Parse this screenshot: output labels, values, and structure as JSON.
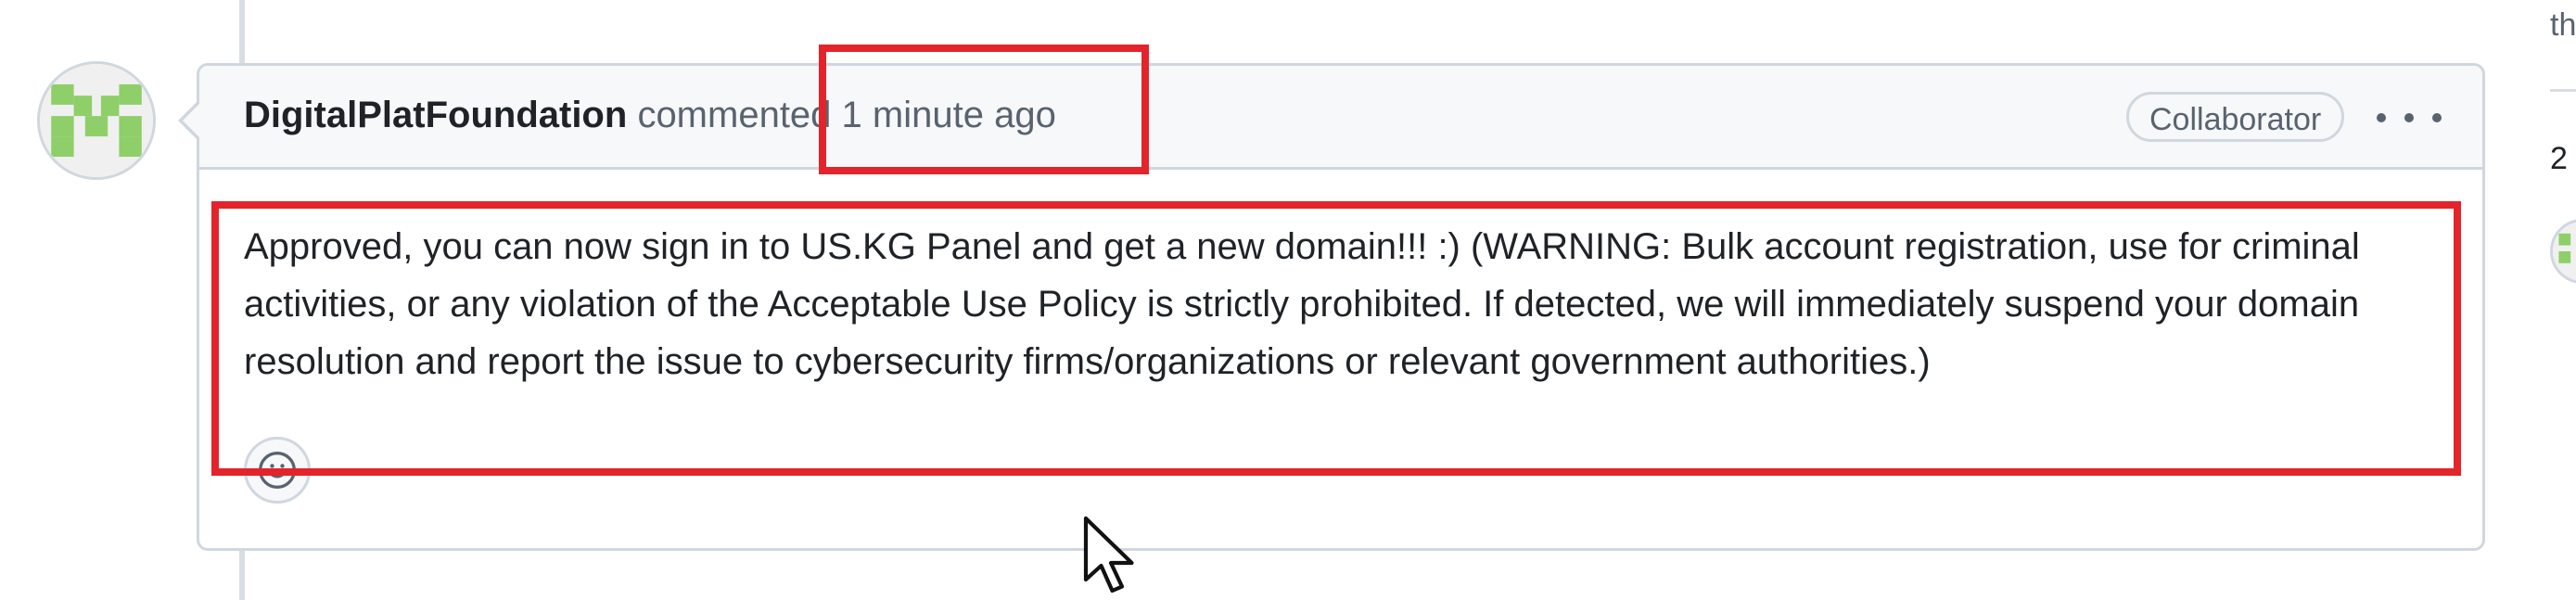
{
  "comment": {
    "author": "DigitalPlatFoundation",
    "action": "commented",
    "timestamp": "1 minute ago",
    "badge": "Collaborator",
    "body": "Approved, you can now sign in to US.KG Panel and get a new domain!!! :) (WARNING: Bulk account registration, use for criminal activities, or any violation of the Acceptable Use Policy is strictly prohibited. If detected, we will immediately suspend your domain resolution and report the issue to cybersecurity firms/organizations or relevant government authorities.)"
  },
  "sidebar": {
    "text_top": "th",
    "text_count": "2"
  },
  "icons": {
    "options": "kebab-horizontal-icon",
    "reaction": "smiley-icon",
    "avatar": "identicon-avatar",
    "cursor": "mouse-pointer-icon"
  },
  "colors": {
    "highlight": "#e3242b",
    "identicon": "#8fcf6a",
    "border": "#d0d7de",
    "header_bg": "#f6f8fa",
    "muted_text": "#59636e"
  }
}
